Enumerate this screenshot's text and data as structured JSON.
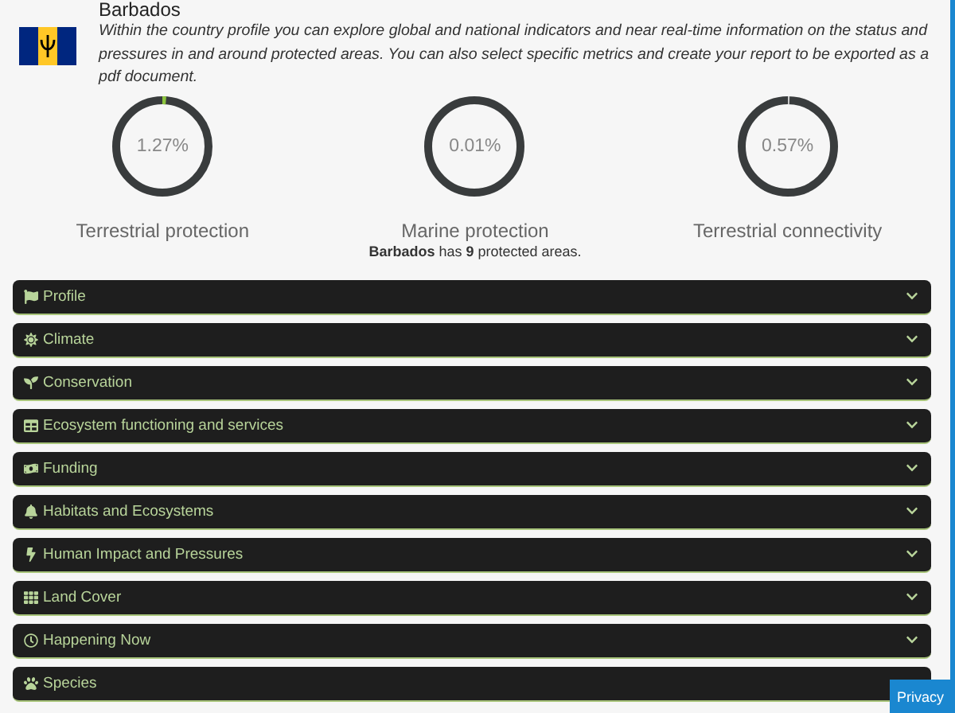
{
  "country": {
    "name": "Barbados",
    "description": "Within the country profile you can explore global and national indicators and near real-time information on the status and pressures in and around protected areas. You can also select specific metrics and create your report to be exported as a pdf document."
  },
  "gauges": [
    {
      "reading": "1.27%",
      "label": "Terrestrial protection",
      "level": 0.0127,
      "color": "#8dc63f"
    },
    {
      "reading": "0.01%",
      "label": "Marine protection"
    },
    {
      "reading": "0.57%",
      "label": "Terrestrial connectivity",
      "level": 0.0057,
      "color": "#cccccc"
    }
  ],
  "summary": "**Barbados** has **9** protected areas.",
  "sections": [
    {
      "label": "Profile"
    },
    {
      "label": "Climate"
    },
    {
      "label": "Conservation"
    },
    {
      "label": "Ecosystem functioning and services"
    },
    {
      "label": "Funding"
    },
    {
      "label": "Habitats and Ecosystems"
    },
    {
      "label": "Human Impact and Pressures"
    },
    {
      "label": "Land Cover"
    },
    {
      "label": "Happening Now"
    },
    {
      "label": "Species"
    }
  ],
  "privacy_button": "Privacy"
}
